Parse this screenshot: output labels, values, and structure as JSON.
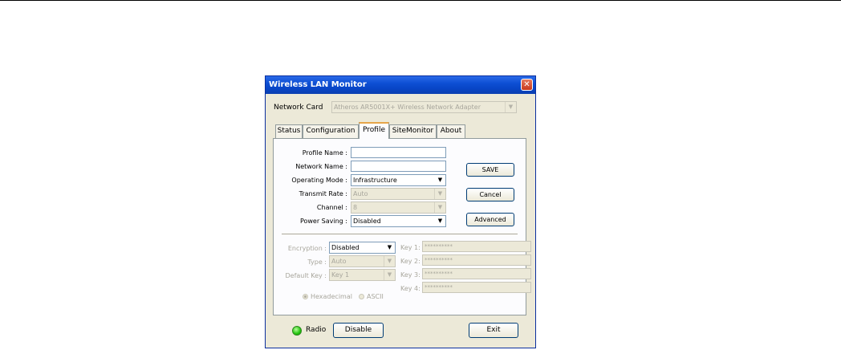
{
  "window": {
    "title": "Wireless LAN Monitor"
  },
  "network_card": {
    "label": "Network Card",
    "value": "Atheros AR5001X+ Wireless Network Adapter"
  },
  "tabs": [
    {
      "label": "Status",
      "active": false
    },
    {
      "label": "Configuration",
      "active": false
    },
    {
      "label": "Profile",
      "active": true
    },
    {
      "label": "SiteMonitor",
      "active": false
    },
    {
      "label": "About",
      "active": false
    }
  ],
  "profile": {
    "profile_name_label": "Profile Name :",
    "profile_name_value": "",
    "network_name_label": "Network Name :",
    "network_name_value": "",
    "operating_mode_label": "Operating Mode :",
    "operating_mode_value": "Infrastructure",
    "transmit_rate_label": "Transmit Rate :",
    "transmit_rate_value": "Auto",
    "channel_label": "Channel :",
    "channel_value": "8",
    "power_saving_label": "Power Saving :",
    "power_saving_value": "Disabled"
  },
  "buttons": {
    "save": "SAVE",
    "cancel": "Cancel",
    "advanced": "Advanced"
  },
  "security": {
    "encryption_label": "Encryption :",
    "encryption_value": "Disabled",
    "type_label": "Type :",
    "type_value": "Auto",
    "default_key_label": "Default Key :",
    "default_key_value": "Key 1",
    "keys": [
      {
        "label": "Key 1:",
        "value": "**********"
      },
      {
        "label": "Key 2:",
        "value": "**********"
      },
      {
        "label": "Key 3:",
        "value": "**********"
      },
      {
        "label": "Key 4:",
        "value": "**********"
      }
    ],
    "format_hex": "Hexadecimal",
    "format_ascii": "ASCII",
    "format_selected": "Hexadecimal"
  },
  "footer": {
    "radio_label": "Radio",
    "disable_button": "Disable",
    "exit_button": "Exit",
    "radio_status_color": "#22c40e"
  }
}
